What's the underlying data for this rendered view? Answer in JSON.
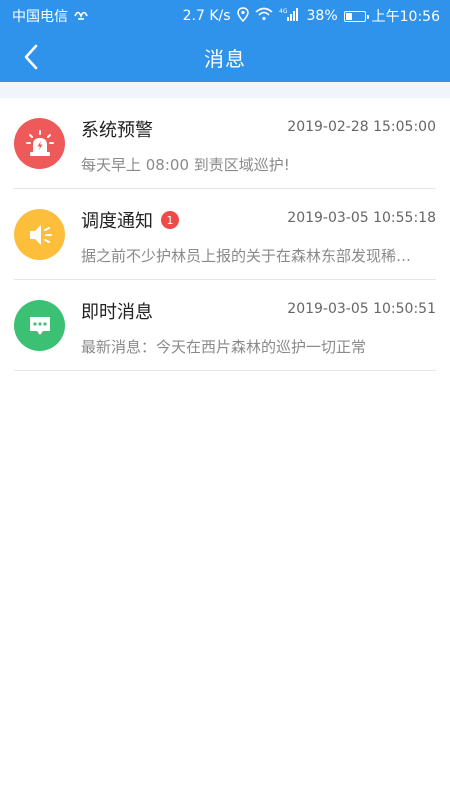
{
  "status_bar": {
    "carrier": "中国电信",
    "speed": "2.7 K/s",
    "network": "4G",
    "battery_percent": "38%",
    "battery_level": 0.38,
    "time": "上午10:56"
  },
  "header": {
    "title": "消息",
    "back_icon": "chevron-left-icon",
    "background": "#2f93ec"
  },
  "messages": [
    {
      "icon": "alarm-light-icon",
      "color": "#ee5a5a",
      "title": "系统预警",
      "badge": "",
      "time": "2019-02-28 15:05:00",
      "preview": "每天早上 08:00 到责区域巡护!"
    },
    {
      "icon": "speaker-icon",
      "color": "#fdbf3b",
      "title": "调度通知",
      "badge": "1",
      "time": "2019-03-05 10:55:18",
      "preview": "据之前不少护林员上报的关于在森林东部发现稀…"
    },
    {
      "icon": "chat-bubble-icon",
      "color": "#3cc174",
      "title": "即时消息",
      "badge": "",
      "time": "2019-03-05 10:50:51",
      "preview": "最新消息：今天在西片森林的巡护一切正常"
    }
  ]
}
